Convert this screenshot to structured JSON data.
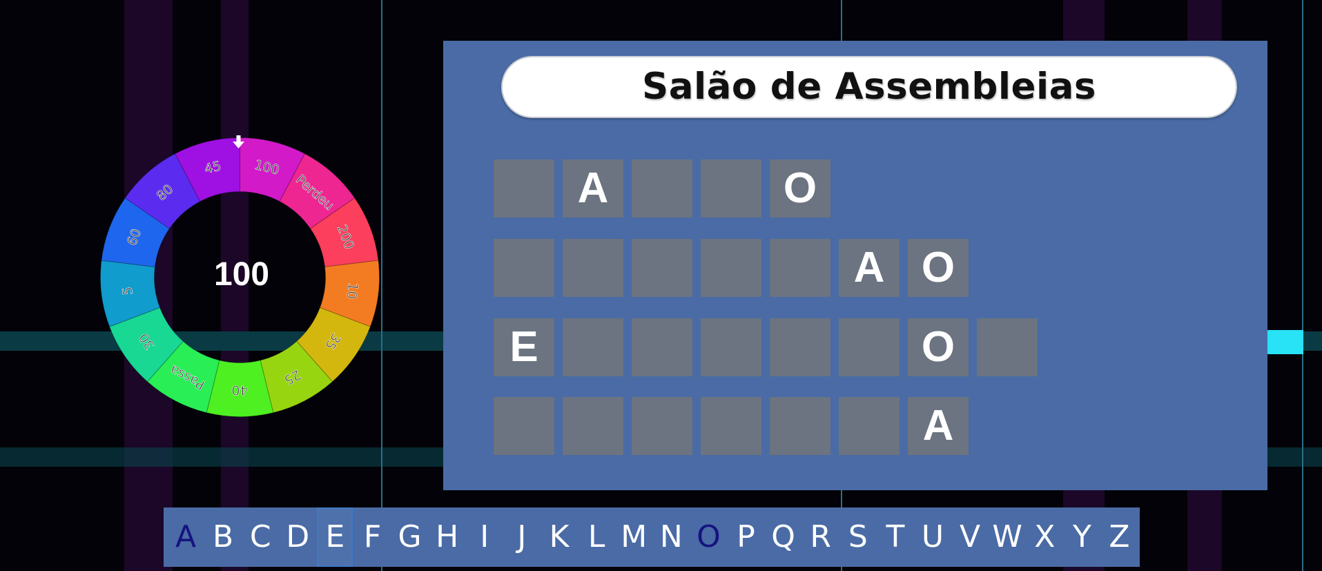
{
  "wheel": {
    "current_value": "100",
    "pointer_icon": "down-arrow-icon",
    "segments": [
      {
        "label": "100",
        "color": "#d21ac9"
      },
      {
        "label": "Perdeu",
        "color": "#ee2692"
      },
      {
        "label": "200",
        "color": "#fb3f5c"
      },
      {
        "label": "10",
        "color": "#f37c22"
      },
      {
        "label": "35",
        "color": "#d3b70f"
      },
      {
        "label": "25",
        "color": "#98d511"
      },
      {
        "label": "40",
        "color": "#4ef021"
      },
      {
        "label": "Passa",
        "color": "#29ee56"
      },
      {
        "label": "30",
        "color": "#18d894"
      },
      {
        "label": "5",
        "color": "#109ccc"
      },
      {
        "label": "60",
        "color": "#1f66ee"
      },
      {
        "label": "80",
        "color": "#5b2cf0"
      },
      {
        "label": "45",
        "color": "#9f10e2"
      }
    ]
  },
  "board": {
    "title": "Salão de Assembleias",
    "rows": [
      [
        "",
        "A",
        "",
        "",
        "O"
      ],
      [
        "",
        "",
        "",
        "",
        "",
        "A",
        "O"
      ],
      [
        "E",
        "",
        "",
        "",
        "",
        "",
        "O",
        ""
      ],
      [
        "",
        "",
        "",
        "",
        "",
        "",
        "A"
      ]
    ]
  },
  "alphabet": {
    "letters": [
      "A",
      "B",
      "C",
      "D",
      "E",
      "F",
      "G",
      "H",
      "I",
      "J",
      "K",
      "L",
      "M",
      "N",
      "O",
      "P",
      "Q",
      "R",
      "S",
      "T",
      "U",
      "V",
      "W",
      "X",
      "Y",
      "Z"
    ],
    "used": [
      "A",
      "O"
    ],
    "selected": "E"
  },
  "colors": {
    "board_bg": "#4a6ba5",
    "tile_bg": "#6b7480",
    "used_letter": "#15137f"
  }
}
